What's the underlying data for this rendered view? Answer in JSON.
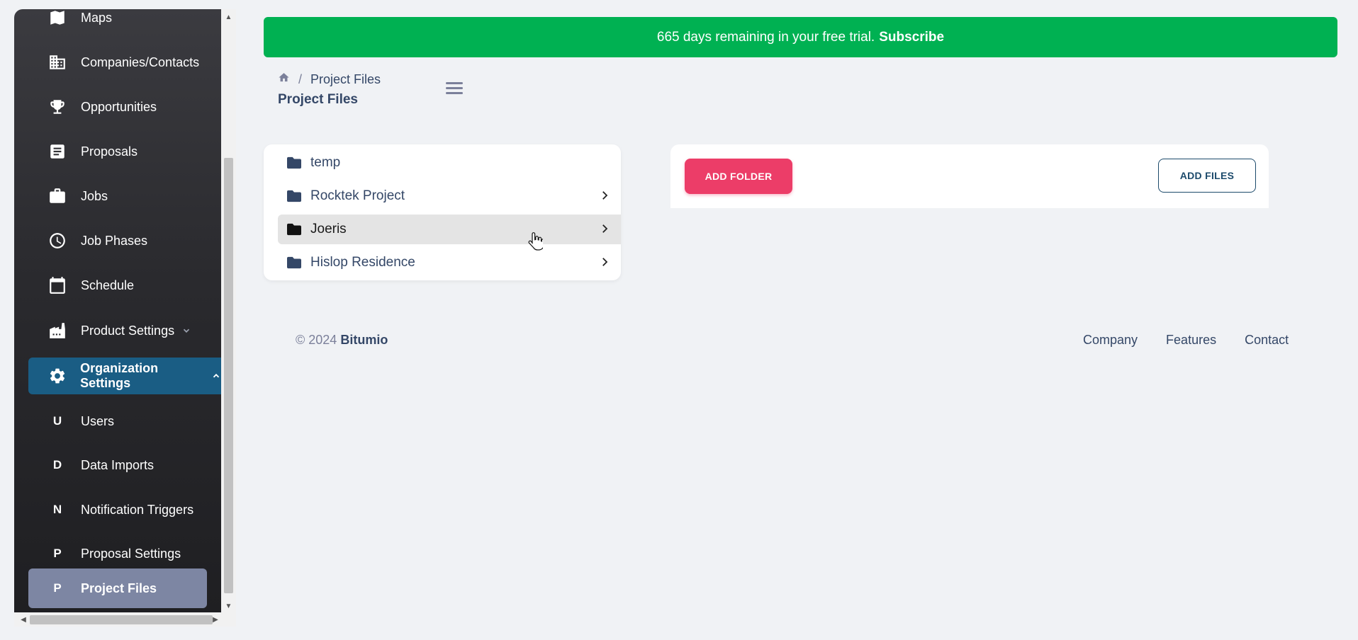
{
  "sidebar": {
    "items": [
      {
        "label": "Maps",
        "icon": "map-icon"
      },
      {
        "label": "Companies/Contacts",
        "icon": "building-icon"
      },
      {
        "label": "Opportunities",
        "icon": "trophy-icon"
      },
      {
        "label": "Proposals",
        "icon": "document-icon"
      },
      {
        "label": "Jobs",
        "icon": "briefcase-icon"
      },
      {
        "label": "Job Phases",
        "icon": "clock-icon"
      },
      {
        "label": "Schedule",
        "icon": "calendar-icon"
      },
      {
        "label": "Product Settings",
        "icon": "factory-icon"
      },
      {
        "label": "Organization Settings",
        "icon": "gear-icon"
      }
    ],
    "sub_items": [
      {
        "letter": "U",
        "label": "Users"
      },
      {
        "letter": "D",
        "label": "Data Imports"
      },
      {
        "letter": "N",
        "label": "Notification Triggers"
      },
      {
        "letter": "P",
        "label": "Proposal Settings"
      },
      {
        "letter": "P",
        "label": "Project Files"
      }
    ],
    "active_color": "#7d86a3",
    "org_color": "#1a5d84"
  },
  "banner": {
    "text": "665 days remaining in your free trial.",
    "link": "Subscribe",
    "color": "#00b152"
  },
  "breadcrumb": {
    "current": "Project Files",
    "separator": "/"
  },
  "page_title": "Project Files",
  "folders": [
    {
      "name": "temp",
      "has_children": false
    },
    {
      "name": "Rocktek Project",
      "has_children": true
    },
    {
      "name": "Joeris",
      "has_children": true
    },
    {
      "name": "Hislop Residence",
      "has_children": true
    }
  ],
  "actions": {
    "add_folder": "ADD FOLDER",
    "add_files": "ADD FILES",
    "add_folder_color": "#ec3d68"
  },
  "footer": {
    "copyright": "© 2024",
    "brand": "Bitumio",
    "links": [
      "Company",
      "Features",
      "Contact"
    ]
  }
}
